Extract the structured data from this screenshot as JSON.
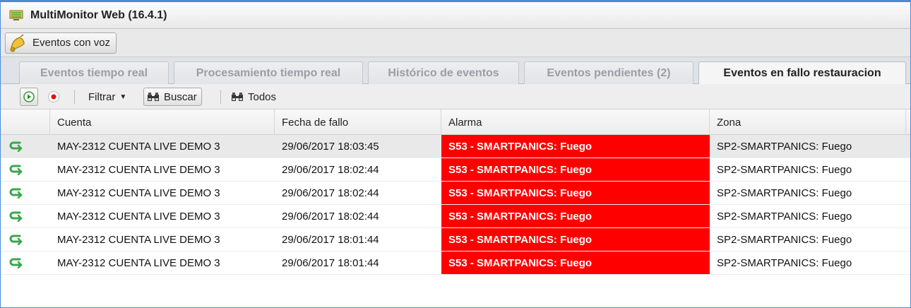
{
  "window": {
    "title": "MultiMonitor Web (16.4.1)"
  },
  "toolbar": {
    "voice_button": "Eventos con voz"
  },
  "tabs": [
    {
      "label": "Eventos tiempo real",
      "active": false
    },
    {
      "label": "Procesamiento tiempo real",
      "active": false
    },
    {
      "label": "Histórico de eventos",
      "active": false
    },
    {
      "label": "Eventos pendientes (2)",
      "active": false
    },
    {
      "label": "Eventos en fallo restauracion",
      "active": true
    }
  ],
  "grid_toolbar": {
    "filter_label": "Filtrar",
    "search_label": "Buscar",
    "all_label": "Todos"
  },
  "columns": [
    "Cuenta",
    "Fecha de fallo",
    "Alarma",
    "Zona"
  ],
  "rows": [
    {
      "cuenta": "MAY-2312 CUENTA LIVE DEMO 3",
      "fecha": "29/06/2017 18:03:45",
      "alarma": "S53 - SMARTPANICS: Fuego",
      "zona": "SP2-SMARTPANICS: Fuego",
      "selected": true
    },
    {
      "cuenta": "MAY-2312 CUENTA LIVE DEMO 3",
      "fecha": "29/06/2017 18:02:44",
      "alarma": "S53 - SMARTPANICS: Fuego",
      "zona": "SP2-SMARTPANICS: Fuego",
      "selected": false
    },
    {
      "cuenta": "MAY-2312 CUENTA LIVE DEMO 3",
      "fecha": "29/06/2017 18:02:44",
      "alarma": "S53 - SMARTPANICS: Fuego",
      "zona": "SP2-SMARTPANICS: Fuego",
      "selected": false
    },
    {
      "cuenta": "MAY-2312 CUENTA LIVE DEMO 3",
      "fecha": "29/06/2017 18:02:44",
      "alarma": "S53 - SMARTPANICS: Fuego",
      "zona": "SP2-SMARTPANICS: Fuego",
      "selected": false
    },
    {
      "cuenta": "MAY-2312 CUENTA LIVE DEMO 3",
      "fecha": "29/06/2017 18:01:44",
      "alarma": "S53 - SMARTPANICS: Fuego",
      "zona": "SP2-SMARTPANICS: Fuego",
      "selected": false
    },
    {
      "cuenta": "MAY-2312 CUENTA LIVE DEMO 3",
      "fecha": "29/06/2017 18:01:44",
      "alarma": "S53 - SMARTPANICS: Fuego",
      "zona": "SP2-SMARTPANICS: Fuego",
      "selected": false
    }
  ],
  "colors": {
    "alarm_bg": "#ff0000",
    "frame_border": "#4a8ad8",
    "row_icon": "#3aa64b"
  },
  "icons": {
    "title": "monitor-app-icon",
    "voice": "bell-icon",
    "play": "play-icon",
    "stop": "stop-icon",
    "filter": "chevron-down-icon",
    "search": "binoculars-icon",
    "row": "restore-arrow-icon"
  }
}
